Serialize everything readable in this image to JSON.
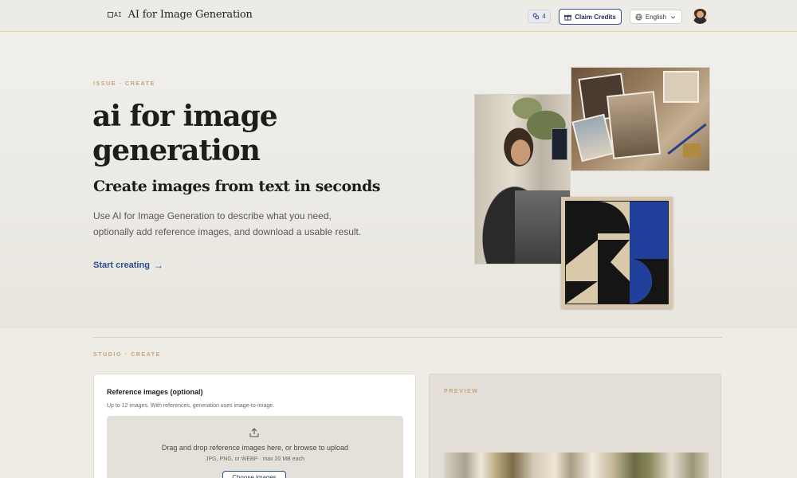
{
  "header": {
    "logo_mark": "AI",
    "app_name": "AI for Image Generation",
    "credits_count": "4",
    "claim_label": "Claim Credits",
    "language": "English"
  },
  "hero": {
    "eyebrow": "ISSUE · CREATE",
    "title": "ai for image generation",
    "subtitle": "Create images from text in seconds",
    "description": "Use AI for Image Generation to describe what you need, optionally add reference images, and download a usable result.",
    "cta_label": "Start creating",
    "cta_arrow": "→"
  },
  "studio": {
    "eyebrow": "STUDIO · CREATE",
    "reference": {
      "title": "Reference images (optional)",
      "help": "Up to 12 images. With references, generation uses image-to-image.",
      "drop_text": "Drag and drop reference images here, or browse to upload",
      "drop_sub": "JPG, PNG, or WEBP · max 20 MB each",
      "browse_label": "Choose images"
    },
    "preview": {
      "eyebrow": "PREVIEW"
    }
  },
  "colors": {
    "accent": "#2b4c8c",
    "eyebrow": "#c6a37b",
    "background": "#efece6",
    "rule": "#e1cfa8"
  },
  "icons": [
    "link-icon",
    "gift-icon",
    "globe-icon",
    "chevron-down-icon",
    "upload-icon"
  ]
}
